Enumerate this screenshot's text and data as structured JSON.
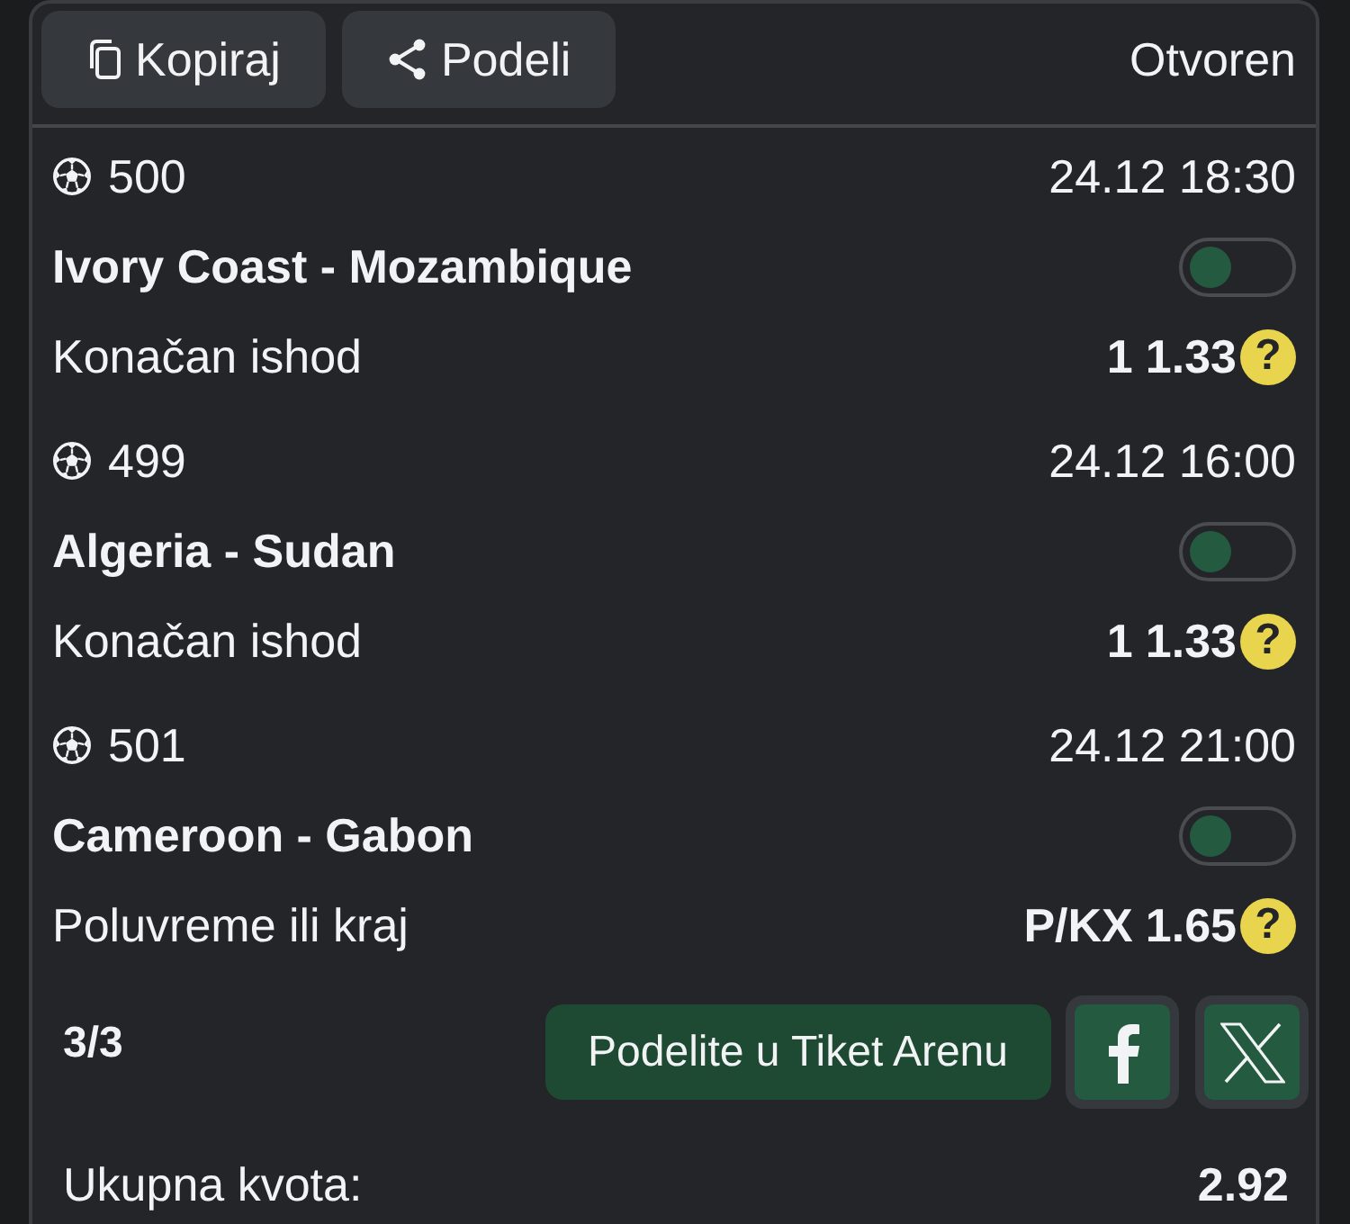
{
  "header": {
    "buttons": [
      {
        "label": "Kopiraj"
      },
      {
        "label": "Podeli"
      }
    ],
    "status": "Otvoren"
  },
  "events": [
    {
      "code": "500",
      "datetime": "24.12 18:30",
      "match": "Ivory Coast - Mozambique",
      "toggle_on": false,
      "market": "Konačan ishod",
      "pick": "1",
      "odds": "1.33",
      "hint": "?"
    },
    {
      "code": "499",
      "datetime": "24.12 16:00",
      "match": "Algeria - Sudan",
      "toggle_on": false,
      "market": "Konačan ishod",
      "pick": "1",
      "odds": "1.33",
      "hint": "?"
    },
    {
      "code": "501",
      "datetime": "24.12 21:00",
      "match": "Cameroon - Gabon",
      "toggle_on": false,
      "market": "Poluvreme ili kraj",
      "pick": "P/KX",
      "odds": "1.65",
      "hint": "?"
    }
  ],
  "footer": {
    "count": "3/3",
    "share_button": "Podelite u Tiket Arenu"
  },
  "total": {
    "label": "Ukupna kvota:",
    "value": "2.92"
  }
}
